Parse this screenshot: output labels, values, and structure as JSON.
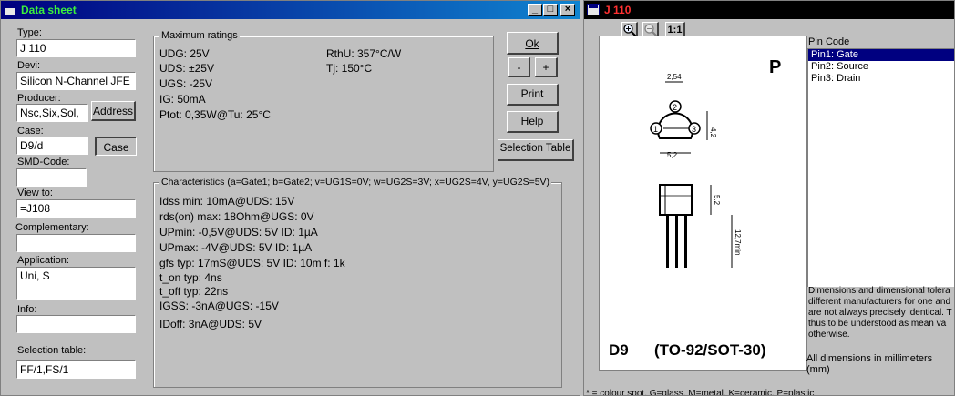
{
  "datasheet": {
    "title": "Data sheet",
    "labels": {
      "type": "Type:",
      "device": "Devi:",
      "producer": "Producer:",
      "case": "Case:",
      "smd": "SMD-Code:",
      "view_to": "View to:",
      "complementary": "Complementary:",
      "application": "Application:",
      "info": "Info:",
      "selection_table": "Selection table:"
    },
    "fields": {
      "type": "J 110",
      "device": "Silicon N-Channel JFE",
      "producer": "Nsc,Six,Sol,",
      "case": "D9/d",
      "smd": "",
      "view_to": "=J108",
      "complementary": "",
      "application": "Uni, S",
      "info": "",
      "selection_table": "FF/1,FS/1"
    },
    "buttons": {
      "address": "Address",
      "case": "Case",
      "ok": "Ok",
      "minus": "-",
      "plus": "+",
      "print": "Print",
      "help": "Help",
      "selection_table": "Selection Table"
    },
    "max_ratings": {
      "title": "Maximum ratings",
      "left": [
        "UDG: 25V",
        "UDS: ±25V",
        "UGS: -25V",
        "IG: 50mA",
        "Ptot: 0,35W@Tu: 25°C"
      ],
      "right": [
        "RthU: 357°C/W",
        "Tj: 150°C"
      ]
    },
    "characteristics": {
      "title": "Characteristics (a=Gate1; b=Gate2; v=UG1S=0V; w=UG2S=3V; x=UG2S=4V, y=UG2S=5V)",
      "lines": [
        "Idss min: 10mA@UDS: 15V",
        "rds(on) max: 18Ohm@UGS: 0V",
        "UPmin: -0,5V@UDS: 5V ID: 1µA",
        "UPmax: -4V@UDS: 5V ID: 1µA",
        "gfs typ: 17mS@UDS: 5V ID: 10m f: 1k",
        "t_on typ: 4ns",
        "t_off typ: 22ns",
        "IGSS: -3nA@UGS: -15V",
        "IDoff: 3nA@UDS: 5V"
      ]
    }
  },
  "pinview": {
    "title": "J 110",
    "zoom_label": "1:1",
    "pin_code_label": "Pin Code",
    "pins": [
      "Pin1: Gate",
      "Pin2: Source",
      "Pin3: Drain"
    ],
    "drawing": {
      "letter": "P",
      "case_code": "D9",
      "package": "(TO-92/SOT-30)",
      "dims": [
        "2,54",
        "4,2",
        "5,2",
        "5,2",
        "12,7min"
      ],
      "pin_numbers": [
        "1",
        "2",
        "3"
      ]
    },
    "note_lines": [
      "Dimensions and dimensional tolera",
      "different manufacturers for one and",
      "are not always precisely identical. T",
      "thus to be understood as mean va",
      "otherwise."
    ],
    "units_note": "All dimensions in millimeters (mm)",
    "footer_note": "* = colour spot, G=glass, M=metal, K=ceramic, P=plastic"
  }
}
